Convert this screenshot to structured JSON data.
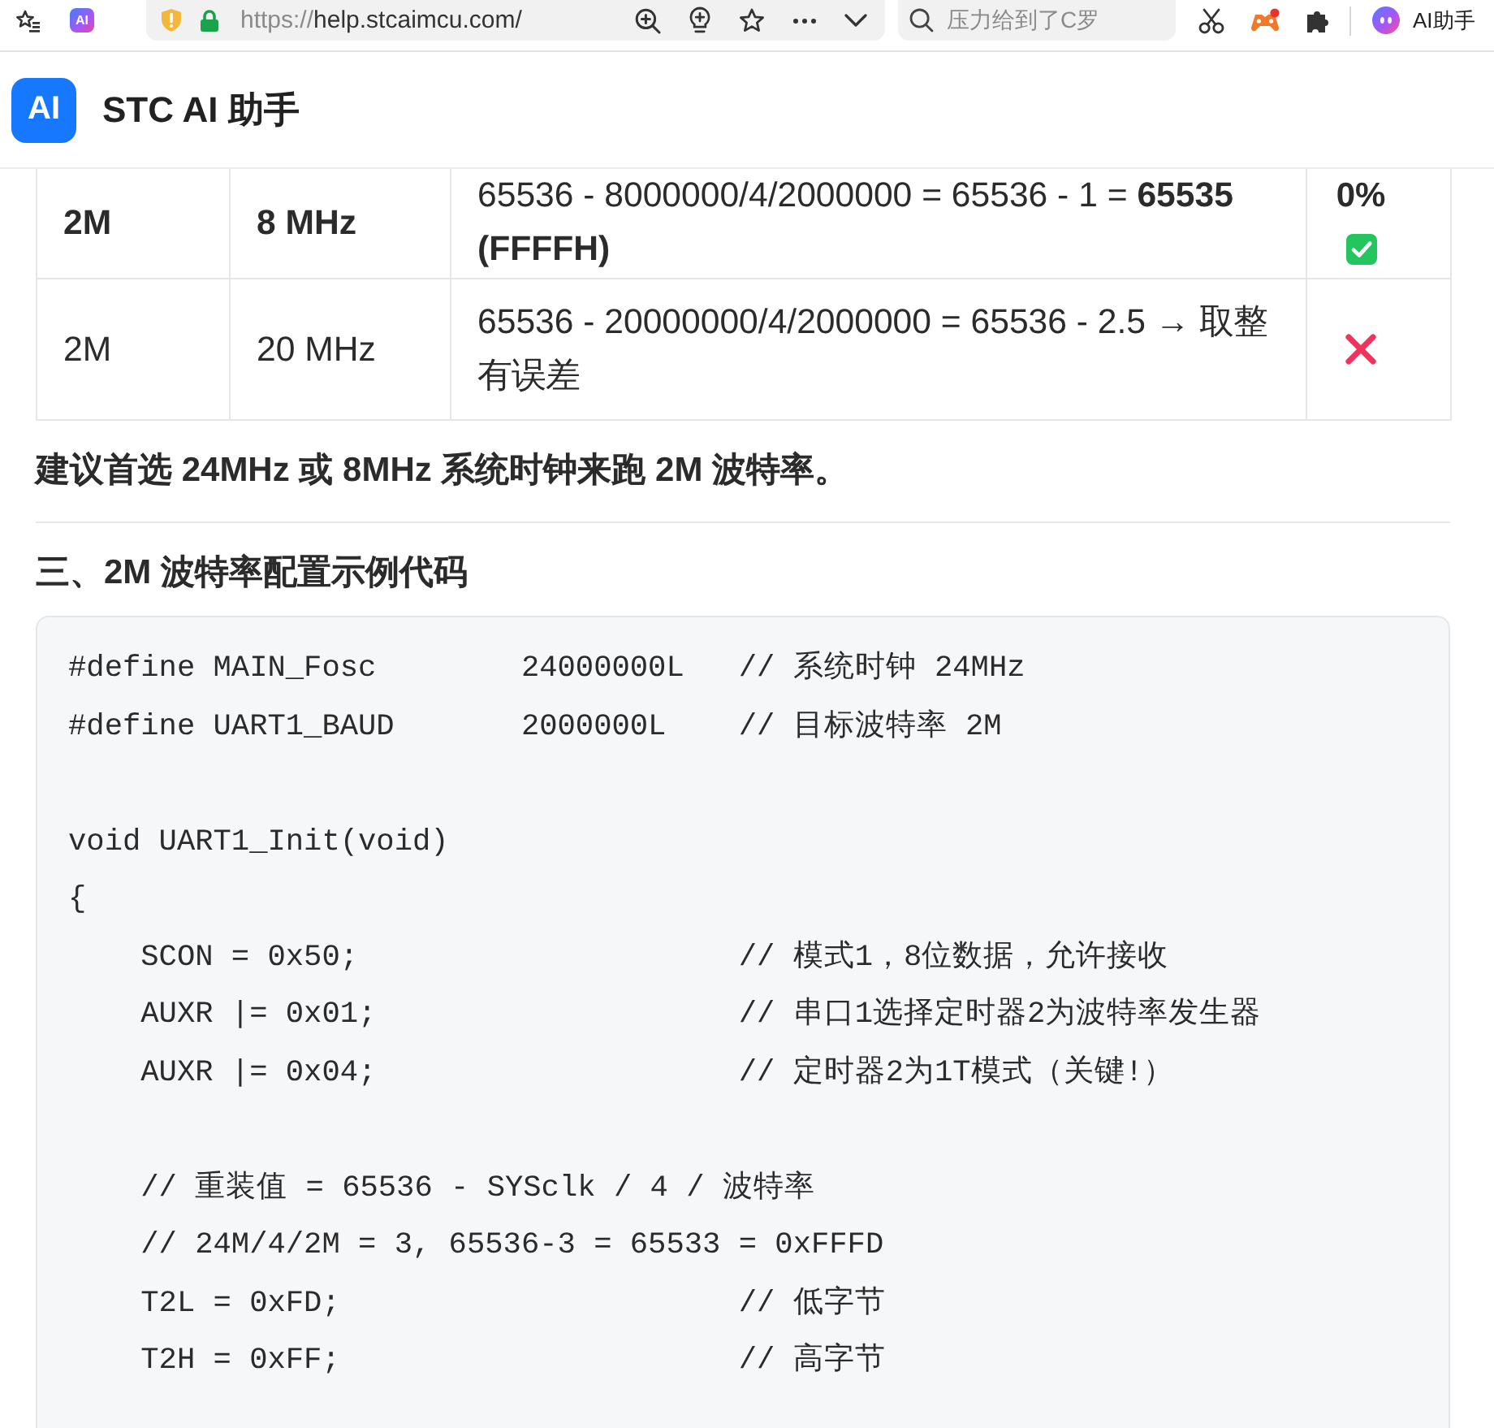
{
  "browser": {
    "tab_icon": "AI",
    "url": {
      "scheme": "https://",
      "host": "help.stcaimcu.com/"
    },
    "search": {
      "placeholder": "压力给到了C罗"
    },
    "assistant_label": "AI助手"
  },
  "app": {
    "logo": "AI",
    "title": "STC AI 助手"
  },
  "table": {
    "rows": [
      {
        "highlighted": true,
        "cells": [
          "2M",
          "8 MHz",
          "65536 - 8000000/4/2000000 = 65536 - 1 = **65535 (FFFFH)**"
        ],
        "result": {
          "text": "0%",
          "passed": true
        }
      },
      {
        "highlighted": false,
        "cells": [
          "2M",
          "20 MHz",
          "65536 - 20000000/4/2000000 = 65536 - 2.5 → 取整有误差"
        ],
        "result": {
          "passed": false
        }
      }
    ]
  },
  "recommendation": "建议首选 24MHz 或 8MHz 系统时钟来跑 2M 波特率。",
  "section_heading": "三、2M 波特率配置示例代码",
  "code_block": {
    "blocks": [
      {
        "lines": [
          "#define MAIN_Fosc        24000000L   // 系统时钟 24MHz",
          "#define UART1_BAUD       2000000L    // 目标波特率 2M"
        ]
      },
      {
        "lines": [
          "void UART1_Init(void)",
          "{"
        ],
        "children": [
          {
            "lines": [
              "SCON = 0x50;                     // 模式1，8位数据，允许接收",
              "AUXR |= 0x01;                    // 串口1选择定时器2为波特率发生器",
              "AUXR |= 0x04;                    // 定时器2为1T模式（关键!）"
            ]
          },
          {
            "lines": [
              "// 重装值 = 65536 - SYSclk / 4 / 波特率",
              "// 24M/4/2M = 3, 65536-3 = 65533 = 0xFFFD",
              "T2L = 0xFD;                      // 低字节",
              "T2H = 0xFF;                      // 高字节"
            ]
          }
        ]
      }
    ]
  }
}
